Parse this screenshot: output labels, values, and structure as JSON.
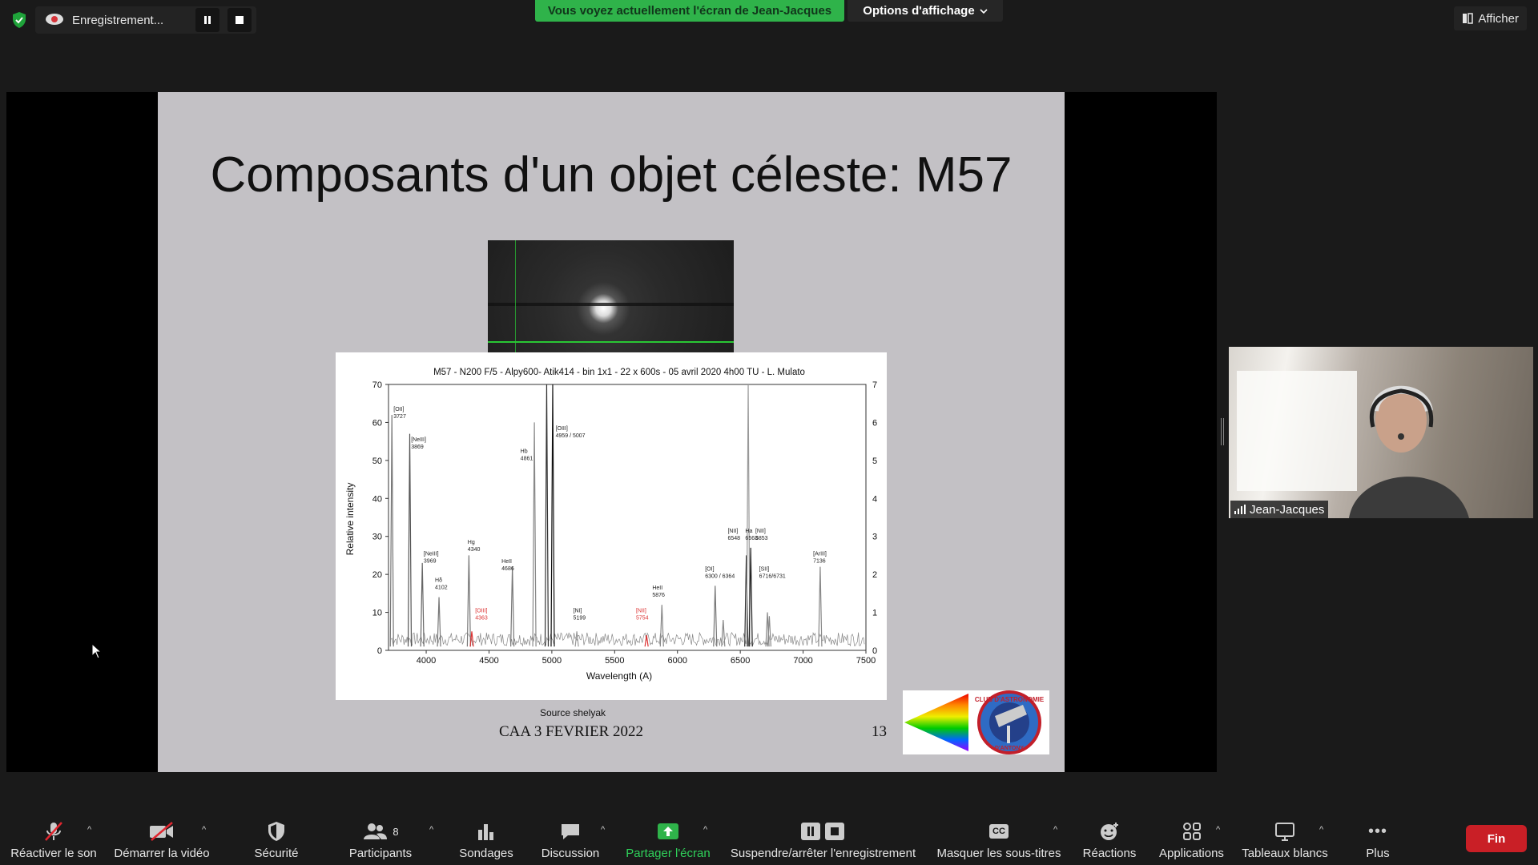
{
  "recording": {
    "label": "Enregistrement..."
  },
  "banner": {
    "sharing_text": "Vous voyez actuellement l'écran de Jean-Jacques",
    "view_options": "Options d'affichage"
  },
  "top_right": {
    "show_label": "Afficher"
  },
  "slide": {
    "title": "Composants d'un objet céleste: M57",
    "source": "Source shelyak",
    "footer_date": "CAA  3 FEVRIER 2022",
    "page_number": "13",
    "logo_text_top": "CLUB D'ASTRONOMIE",
    "logo_text_bottom": "D'ANTONY"
  },
  "chart_data": {
    "type": "line",
    "title": "M57 - N200 F/5 - Alpy600- Atik414 - bin 1x1 - 22 x 600s -  05 avril 2020 4h00 TU - L. Mulato",
    "xlabel": "Wavelength (A)",
    "ylabel": "Relative intensity",
    "xlim": [
      3700,
      7500
    ],
    "ylim": [
      0,
      70
    ],
    "y2lim": [
      0,
      7
    ],
    "xticks": [
      4000,
      4500,
      5000,
      5500,
      6000,
      6500,
      7000,
      7500
    ],
    "yticks": [
      0,
      10,
      20,
      30,
      40,
      50,
      60,
      70
    ],
    "y2ticks": [
      0,
      1,
      2,
      3,
      4,
      5,
      6,
      7
    ],
    "lines": [
      {
        "x": 3727,
        "y": 62,
        "color": "#777"
      },
      {
        "x": 3869,
        "y": 57,
        "color": "#555"
      },
      {
        "x": 3969,
        "y": 23,
        "color": "#666"
      },
      {
        "x": 4102,
        "y": 14,
        "color": "#777"
      },
      {
        "x": 4340,
        "y": 25,
        "color": "#777"
      },
      {
        "x": 4363,
        "y": 5,
        "color": "#d33"
      },
      {
        "x": 4686,
        "y": 22,
        "color": "#777"
      },
      {
        "x": 4861,
        "y": 60,
        "color": "#888"
      },
      {
        "x": 4959,
        "y": 70,
        "color": "#333"
      },
      {
        "x": 5007,
        "y": 70,
        "color": "#111"
      },
      {
        "x": 5199,
        "y": 5,
        "color": "#999"
      },
      {
        "x": 5754,
        "y": 4,
        "color": "#d33"
      },
      {
        "x": 5876,
        "y": 12,
        "color": "#888"
      },
      {
        "x": 6300,
        "y": 17,
        "color": "#777"
      },
      {
        "x": 6364,
        "y": 8,
        "color": "#888"
      },
      {
        "x": 6548,
        "y": 25,
        "color": "#333"
      },
      {
        "x": 6563,
        "y": 70,
        "color": "#999"
      },
      {
        "x": 6583,
        "y": 27,
        "color": "#222"
      },
      {
        "x": 6716,
        "y": 10,
        "color": "#888"
      },
      {
        "x": 6731,
        "y": 9,
        "color": "#888"
      },
      {
        "x": 7136,
        "y": 22,
        "color": "#888"
      }
    ],
    "annotations": [
      {
        "text": "[OII]",
        "sub": "3727",
        "x": 3740,
        "y": 63,
        "color": "#222"
      },
      {
        "text": "[NeIII]",
        "sub": "3869",
        "x": 3880,
        "y": 55,
        "color": "#222"
      },
      {
        "text": "[NeIII]",
        "sub": "3969",
        "x": 3980,
        "y": 25,
        "color": "#222"
      },
      {
        "text": "Hδ",
        "sub": "4102",
        "x": 4070,
        "y": 18,
        "color": "#222"
      },
      {
        "text": "Hg",
        "sub": "4340",
        "x": 4330,
        "y": 28,
        "color": "#222"
      },
      {
        "text": "[OIII]",
        "sub": "4363",
        "x": 4390,
        "y": 10,
        "color": "#d33"
      },
      {
        "text": "HeII",
        "sub": "4686",
        "x": 4600,
        "y": 23,
        "color": "#222"
      },
      {
        "text": "Hb",
        "sub": "4861",
        "x": 4750,
        "y": 52,
        "color": "#222"
      },
      {
        "text": "[OIII]",
        "sub": "4959 / 5007",
        "x": 5030,
        "y": 58,
        "color": "#222"
      },
      {
        "text": "[NI]",
        "sub": "5199",
        "x": 5170,
        "y": 10,
        "color": "#222"
      },
      {
        "text": "[NII]",
        "sub": "5754",
        "x": 5670,
        "y": 10,
        "color": "#d33"
      },
      {
        "text": "HeII",
        "sub": "5876",
        "x": 5800,
        "y": 16,
        "color": "#222"
      },
      {
        "text": "[OI]",
        "sub": "6300 / 6364",
        "x": 6220,
        "y": 21,
        "color": "#222"
      },
      {
        "text": "[NII]",
        "sub": "6548",
        "x": 6400,
        "y": 31,
        "color": "#222"
      },
      {
        "text": "Ha",
        "sub": "6563",
        "x": 6540,
        "y": 31,
        "color": "#222"
      },
      {
        "text": "[NII]",
        "sub": "6853",
        "x": 6620,
        "y": 31,
        "color": "#222"
      },
      {
        "text": "[SII]",
        "sub": "6716/6731",
        "x": 6650,
        "y": 21,
        "color": "#222"
      },
      {
        "text": "[ArIII]",
        "sub": "7136",
        "x": 7080,
        "y": 25,
        "color": "#222"
      }
    ]
  },
  "participant": {
    "name": "Jean-Jacques"
  },
  "toolbar": {
    "unmute": "Réactiver le son",
    "start_video": "Démarrer la vidéo",
    "security": "Sécurité",
    "participants": "Participants",
    "participants_count": "8",
    "polls": "Sondages",
    "chat": "Discussion",
    "share_screen": "Partager l'écran",
    "recording": "Suspendre/arrêter l'enregistrement",
    "captions": "Masquer les sous-titres",
    "reactions": "Réactions",
    "apps": "Applications",
    "whiteboards": "Tableaux blancs",
    "more": "Plus",
    "end": "Fin",
    "cc_glyph": "CC",
    "caret_glyph": "^",
    "more_glyph": "•••"
  },
  "colors": {
    "accent_green": "#2fb34a",
    "end_red": "#c91f26",
    "toolbar_bg": "#1a1a1a"
  }
}
